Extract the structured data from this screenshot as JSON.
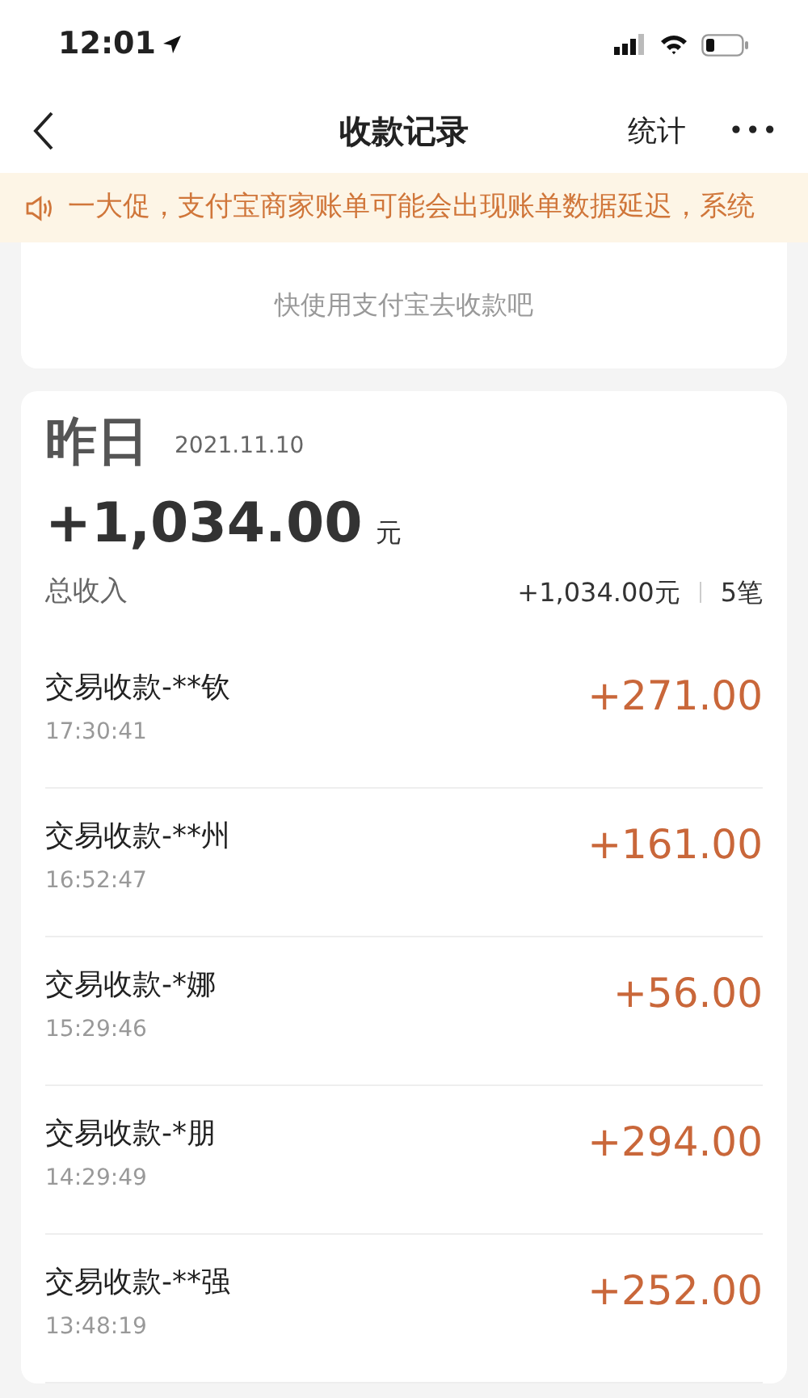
{
  "status_bar": {
    "time": "12:01"
  },
  "nav": {
    "title": "收款记录",
    "action": "统计",
    "more": "•••"
  },
  "notice": {
    "text": "一大促，支付宝商家账单可能会出现账单数据延迟，系统"
  },
  "empty_card": {
    "text": "快使用支付宝去收款吧"
  },
  "day": {
    "label": "昨日",
    "date": "2021.11.10",
    "total": "+1,034.00",
    "unit": "元",
    "summary_label": "总收入",
    "summary_amount": "+1,034.00元",
    "summary_count": "5笔",
    "transactions": [
      {
        "title": "交易收款-**钦",
        "time": "17:30:41",
        "amount": "+271.00"
      },
      {
        "title": "交易收款-**州",
        "time": "16:52:47",
        "amount": "+161.00"
      },
      {
        "title": "交易收款-*娜",
        "time": "15:29:46",
        "amount": "+56.00"
      },
      {
        "title": "交易收款-*朋",
        "time": "14:29:49",
        "amount": "+294.00"
      },
      {
        "title": "交易收款-**强",
        "time": "13:48:19",
        "amount": "+252.00"
      }
    ]
  }
}
